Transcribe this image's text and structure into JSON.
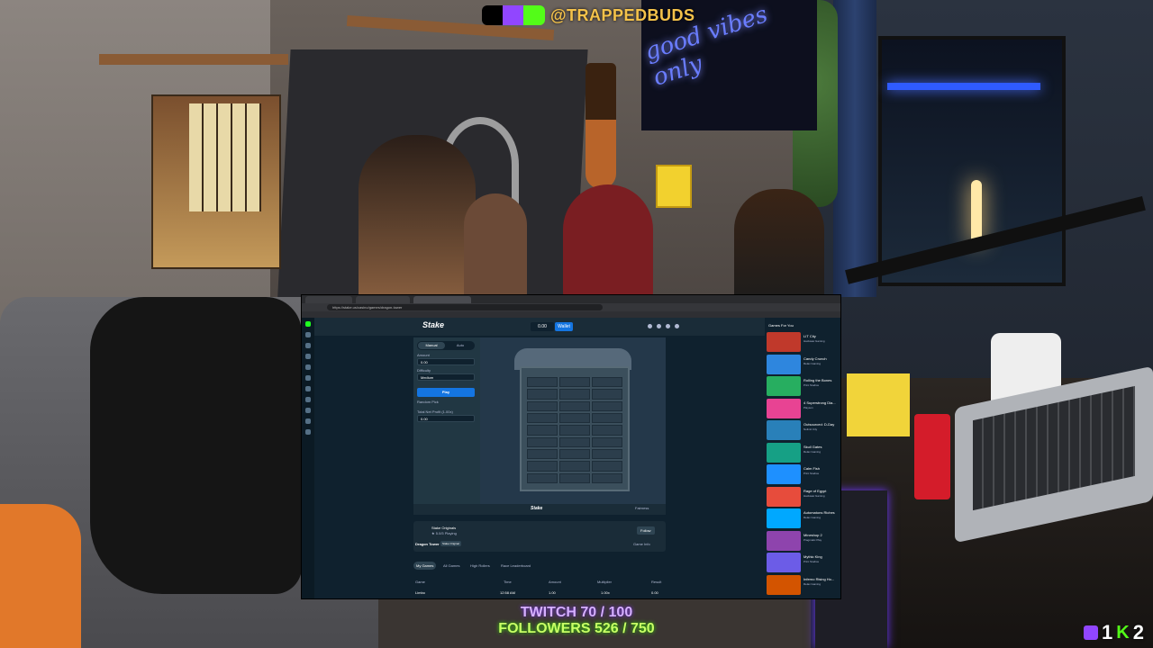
{
  "stream_overlay": {
    "handle": "@TRAPPEDBUDS",
    "neon_sign": "good vibes only",
    "twitch_goal": "TWITCH 70 / 100",
    "followers_goal": "FOLLOWERS 526 / 750",
    "twitch_viewers": "1",
    "kick_viewers": "2",
    "colors": {
      "handle": "#f4c24a",
      "twitch": "#9146ff",
      "kick": "#53fc18"
    }
  },
  "browser": {
    "url": "https://stake.us/casino/games/dragon-tower",
    "app": {
      "logo": "Stake",
      "balance": "0.00",
      "wallet_label": "Wallet"
    },
    "bet_panel": {
      "mode_tabs": [
        "Manual",
        "Auto"
      ],
      "amount_label": "Amount",
      "amount_value": "0.00",
      "difficulty_label": "Difficulty",
      "difficulty_value": "Medium",
      "bet_button": "Play",
      "random_pick": "Random Pick",
      "profit_label": "Total Net Profit (1.00x)",
      "profit_value": "0.00"
    },
    "game_footer": {
      "logo": "Stake",
      "fairness": "Fairness"
    },
    "game_info": {
      "title": "Stake Originals",
      "subtitle": "★ 5.0/5  Playing",
      "name": "Dragon Tower",
      "badge": "Stake Original",
      "description_link": "Game Info",
      "follow": "Follow"
    },
    "bottom_tabs": [
      "My Games",
      "All Games",
      "High Rollers",
      "Race Leaderboard"
    ],
    "table": {
      "headers": [
        "Game",
        "Time",
        "Amount",
        "Multiplier",
        "Result"
      ],
      "rows": [
        [
          "Limbo",
          "12:58 AM",
          "1.00",
          "1.00x",
          "0.00"
        ]
      ]
    },
    "sidebar": {
      "title": "Games For You",
      "items": [
        {
          "name": "LIT City",
          "provider": "Hacksaw Gaming",
          "color": "#c0392b"
        },
        {
          "name": "Candy Crunch",
          "provider": "Relax Gaming",
          "color": "#2e86de"
        },
        {
          "name": "Rolling the Bones",
          "provider": "Print Studios",
          "color": "#27ae60"
        },
        {
          "name": "4 Superstrong Dia...",
          "provider": "Playson",
          "color": "#e84393"
        },
        {
          "name": "Outsourced: D-Day",
          "provider": "Nolimit City",
          "color": "#2980b9"
        },
        {
          "name": "Skull Gates",
          "provider": "Relax Gaming",
          "color": "#16a085"
        },
        {
          "name": "Calm Fish",
          "provider": "Print Studios",
          "color": "#1e90ff"
        },
        {
          "name": "Rage of Egypt",
          "provider": "Hacksaw Gaming",
          "color": "#e74c3c"
        },
        {
          "name": "Automatons Riches",
          "provider": "Relax Gaming",
          "color": "#00a8ff"
        },
        {
          "name": "Mineshop 2",
          "provider": "Pragmatic Play",
          "color": "#8e44ad"
        },
        {
          "name": "Mythic King",
          "provider": "Print Studios",
          "color": "#6c5ce7"
        },
        {
          "name": "Inferno Rising Ho...",
          "provider": "Relax Gaming",
          "color": "#d35400"
        }
      ]
    }
  }
}
